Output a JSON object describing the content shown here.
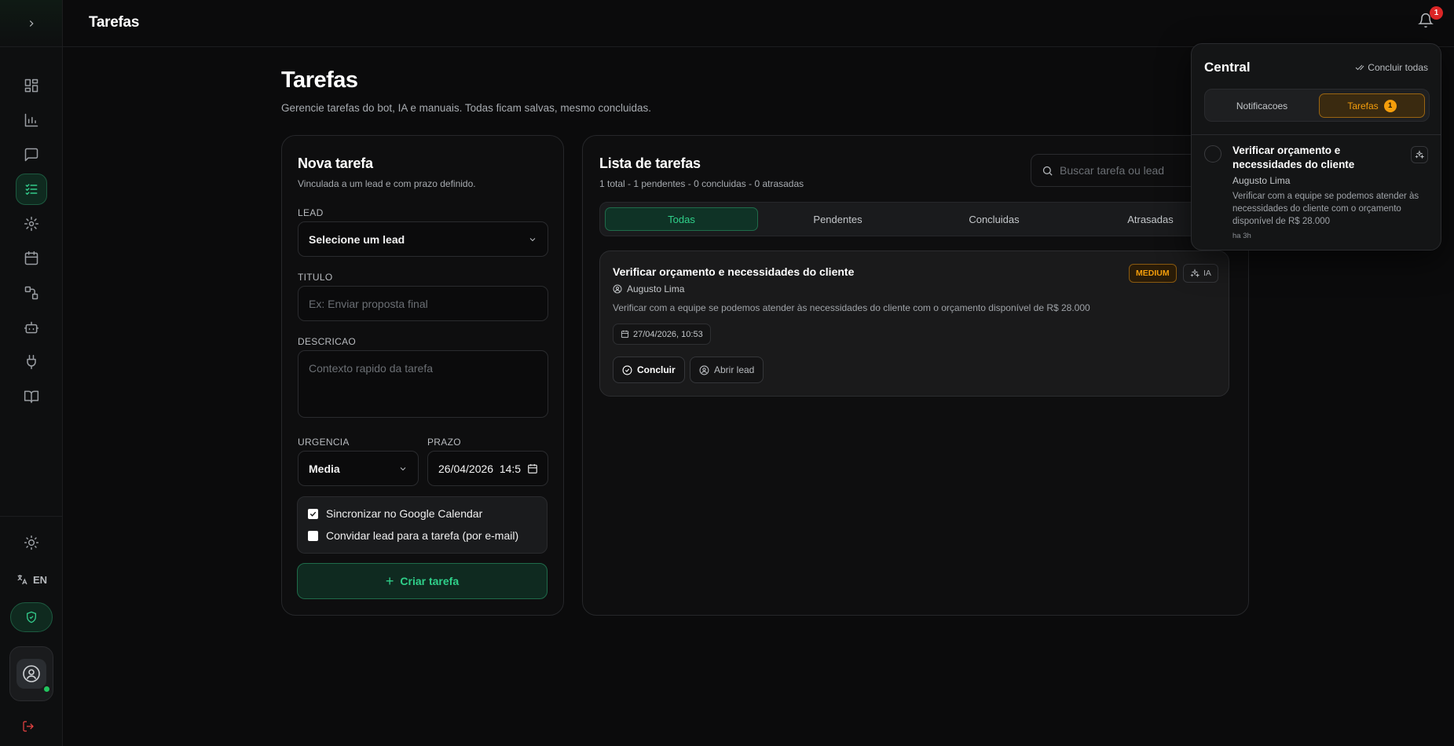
{
  "topbar": {
    "title": "Tarefas",
    "notification_count": "1"
  },
  "sidebar": {
    "items": [
      {
        "name": "dashboard-icon"
      },
      {
        "name": "chart-icon"
      },
      {
        "name": "chat-icon"
      },
      {
        "name": "tasks-icon",
        "active": true
      },
      {
        "name": "gear-icon"
      },
      {
        "name": "calendar-icon"
      },
      {
        "name": "workflow-icon"
      },
      {
        "name": "bot-icon"
      },
      {
        "name": "plug-icon"
      },
      {
        "name": "book-icon"
      }
    ],
    "language": "EN"
  },
  "page": {
    "title": "Tarefas",
    "subtitle": "Gerencie tarefas do bot, IA e manuais. Todas ficam salvas, mesmo concluidas."
  },
  "new_task": {
    "title": "Nova tarefa",
    "subtitle": "Vinculada a um lead e com prazo definido.",
    "lead_label": "LEAD",
    "lead_value": "Selecione um lead",
    "title_label": "TITULO",
    "title_placeholder": "Ex: Enviar proposta final",
    "desc_label": "DESCRICAO",
    "desc_placeholder": "Contexto rapido da tarefa",
    "urgency_label": "URGENCIA",
    "urgency_value": "Media",
    "deadline_label": "PRAZO",
    "deadline_value": "26/04/2026  14:5",
    "sync_label": "Sincronizar no Google Calendar",
    "sync_checked": true,
    "invite_label": "Convidar lead para a tarefa (por e-mail)",
    "invite_checked": false,
    "create_label": "Criar tarefa"
  },
  "task_list": {
    "title": "Lista de tarefas",
    "summary": "1 total - 1 pendentes - 0 concluidas - 0 atrasadas",
    "search_placeholder": "Buscar tarefa ou lead",
    "tabs": [
      "Todas",
      "Pendentes",
      "Concluidas",
      "Atrasadas"
    ],
    "active_tab": "Todas",
    "tasks": [
      {
        "title": "Verificar orçamento e necessidades do cliente",
        "lead": "Augusto Lima",
        "description": "Verificar com a equipe se podemos atender às necessidades do cliente com o orçamento disponível de R$ 28.000",
        "due": "27/04/2026, 10:53",
        "urgency": "MEDIUM",
        "source": "IA",
        "complete_label": "Concluir",
        "open_lead_label": "Abrir lead"
      }
    ]
  },
  "notifications": {
    "title": "Central",
    "complete_all": "Concluir todas",
    "tabs": [
      "Notificacoes",
      "Tarefas"
    ],
    "active_tab": "Tarefas",
    "tasks_count": "1",
    "item": {
      "title": "Verificar orçamento e necessidades do cliente",
      "lead": "Augusto Lima",
      "description": "Verificar com a equipe se podemos atender às necessidades do cliente com o orçamento disponível de R$ 28.000",
      "time": "ha 3h"
    }
  },
  "colors": {
    "accent": "#2fd08a",
    "warning": "#f59e0b",
    "danger": "#dc2626",
    "background": "#0b0b0c"
  }
}
